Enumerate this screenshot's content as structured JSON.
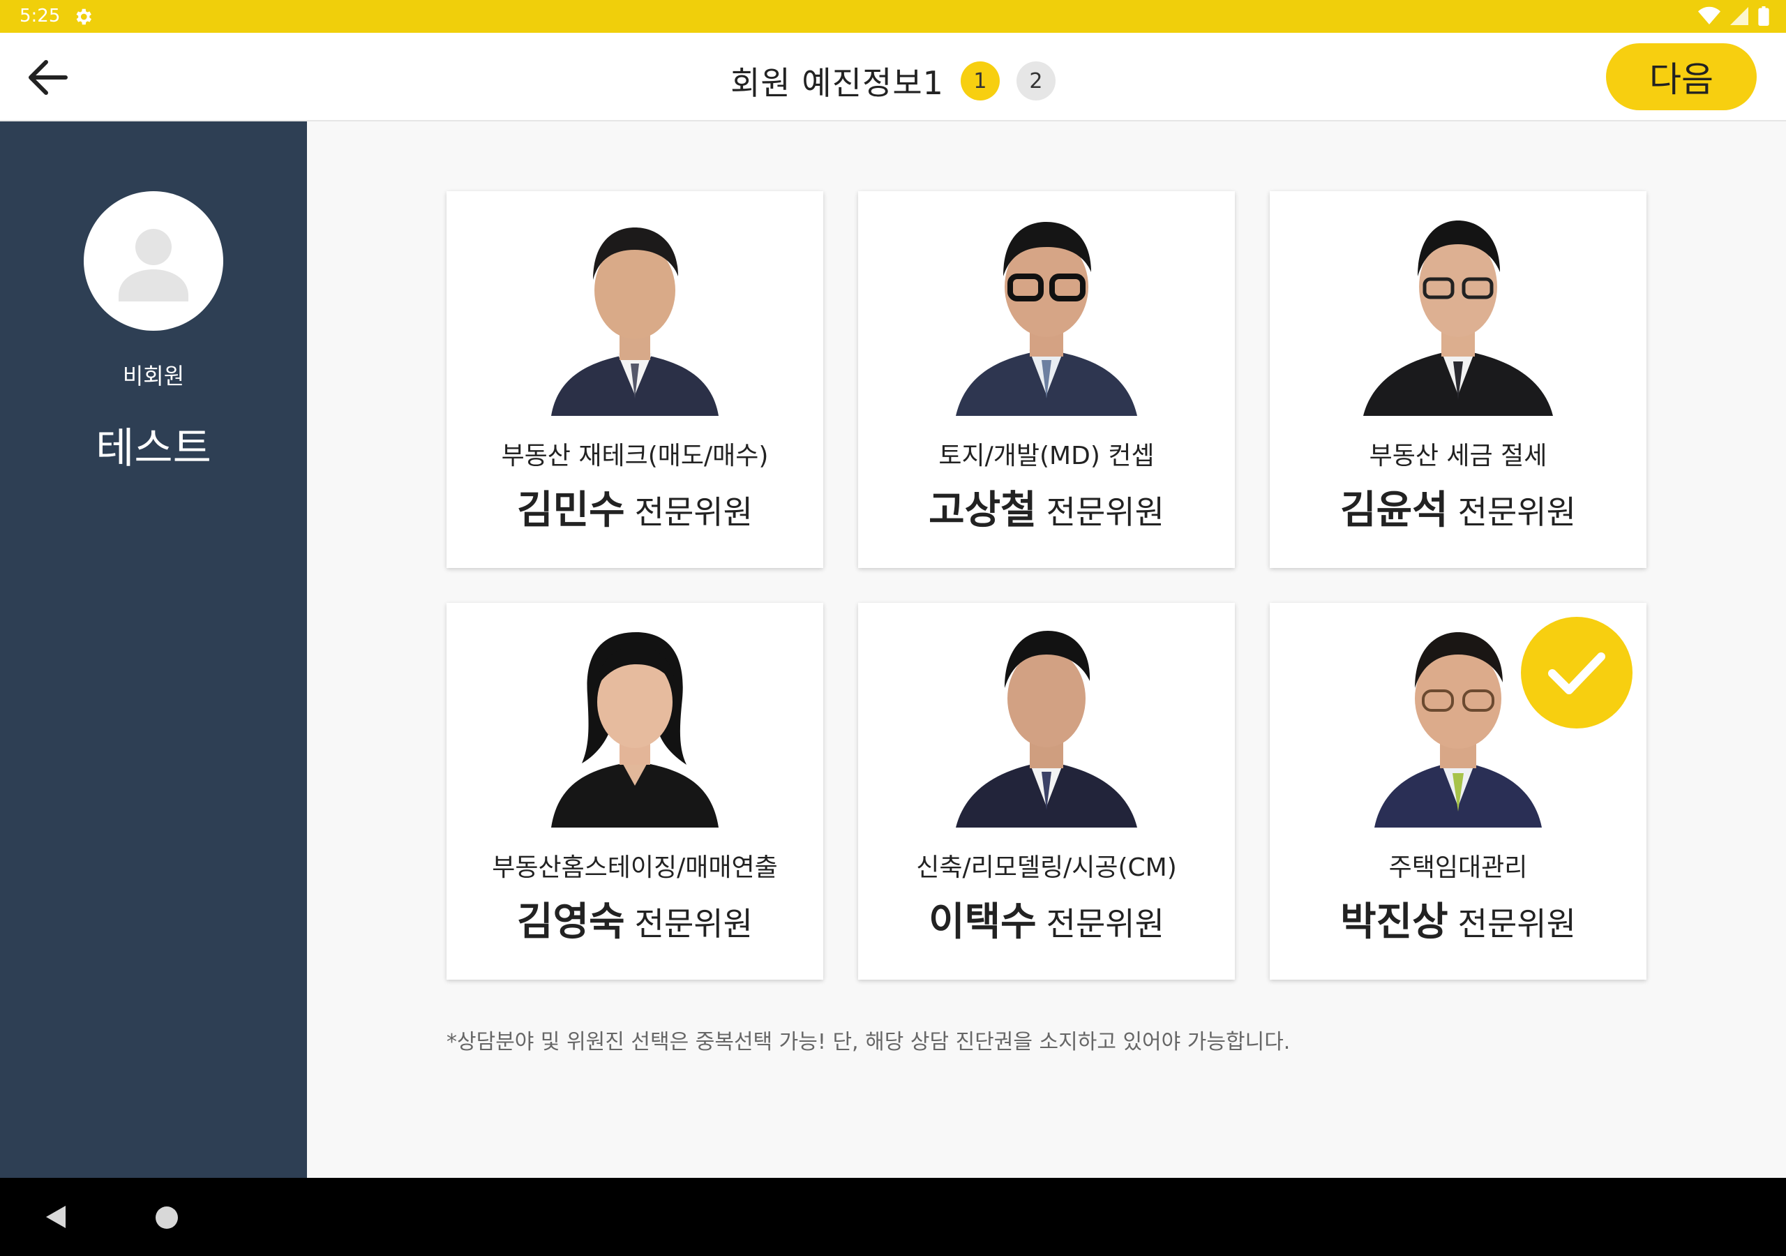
{
  "status_bar": {
    "time": "5:25",
    "icons": [
      "gear-icon",
      "wifi-icon",
      "signal-icon",
      "battery-icon"
    ]
  },
  "header": {
    "title": "회원 예진정보1",
    "steps": [
      {
        "label": "1",
        "active": true
      },
      {
        "label": "2",
        "active": false
      }
    ],
    "next_label": "다음",
    "back_icon": "arrow-left-icon"
  },
  "sidebar": {
    "member_type": "비회원",
    "member_name": "테스트",
    "avatar_icon": "person-icon"
  },
  "experts": [
    {
      "field": "부동산 재테크(매도/매수)",
      "name": "김민수",
      "role": "전문위원",
      "selected": false
    },
    {
      "field": "토지/개발(MD) 컨셉",
      "name": "고상철",
      "role": "전문위원",
      "selected": false
    },
    {
      "field": "부동산 세금 절세",
      "name": "김윤석",
      "role": "전문위원",
      "selected": false
    },
    {
      "field": "부동산홈스테이징/매매연출",
      "name": "김영숙",
      "role": "전문위원",
      "selected": false
    },
    {
      "field": "신축/리모델링/시공(CM)",
      "name": "이택수",
      "role": "전문위원",
      "selected": false
    },
    {
      "field": "주택임대관리",
      "name": "박진상",
      "role": "전문위원",
      "selected": true
    }
  ],
  "note": "*상담분야 및 위원진 선택은 중복선택 가능! 단, 해당 상담 진단권을 소지하고 있어야 가능합니다.",
  "colors": {
    "accent": "#f7cf10",
    "status_bar": "#f0cf0b",
    "sidebar": "#2e3f54"
  },
  "nav": {
    "icons": [
      "nav-back-icon",
      "nav-home-icon"
    ]
  }
}
